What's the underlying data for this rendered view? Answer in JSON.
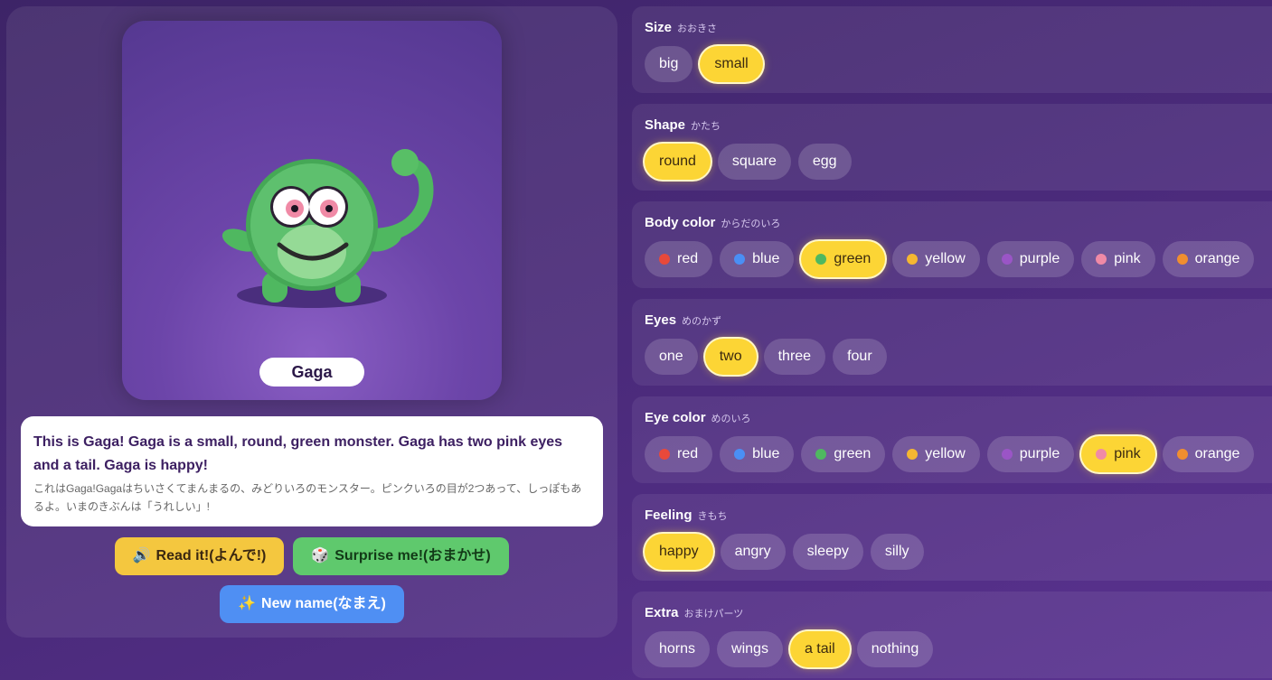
{
  "monster": {
    "name": "Gaga"
  },
  "description": {
    "en": "This is Gaga! Gaga is a small, round, green monster. Gaga has two pink eyes and a tail. Gaga is happy!",
    "jp": "これはGaga!Gagaはちいさくてまんまるの、みどりいろのモンスター。ピンクいろの目が2つあって、しっぽもあるよ。いまのきぶんは「うれしい」!"
  },
  "buttons": {
    "read": {
      "icon": "🔊",
      "label": "Read it!(よんで!)"
    },
    "surprise": {
      "icon": "🎲",
      "label": "Surprise me!(おまかせ)"
    },
    "new_name": {
      "icon": "✨",
      "label": "New name(なまえ)"
    }
  },
  "colors": {
    "red": "#e8493a",
    "blue": "#4a8ff5",
    "green": "#4fb860",
    "yellow": "#f5b731",
    "purple": "#9a55c6",
    "pink": "#f08aa6",
    "orange": "#f08e2f",
    "selected": "#fcd535"
  },
  "sections": {
    "size": {
      "title": "Size",
      "jp": "おおきさ",
      "options": [
        "big",
        "small"
      ],
      "selected": "small"
    },
    "shape": {
      "title": "Shape",
      "jp": "かたち",
      "options": [
        "round",
        "square",
        "egg"
      ],
      "selected": "round"
    },
    "body_color": {
      "title": "Body color",
      "jp": "からだのいろ",
      "options": [
        "red",
        "blue",
        "green",
        "yellow",
        "purple",
        "pink",
        "orange"
      ],
      "selected": "green"
    },
    "eyes": {
      "title": "Eyes",
      "jp": "めのかず",
      "options": [
        "one",
        "two",
        "three",
        "four"
      ],
      "selected": "two"
    },
    "eye_color": {
      "title": "Eye color",
      "jp": "めのいろ",
      "options": [
        "red",
        "blue",
        "green",
        "yellow",
        "purple",
        "pink",
        "orange"
      ],
      "selected": "pink"
    },
    "feeling": {
      "title": "Feeling",
      "jp": "きもち",
      "options": [
        "happy",
        "angry",
        "sleepy",
        "silly"
      ],
      "selected": "happy"
    },
    "extra": {
      "title": "Extra",
      "jp": "おまけパーツ",
      "options": [
        "horns",
        "wings",
        "a tail",
        "nothing"
      ],
      "selected": "a tail"
    }
  }
}
